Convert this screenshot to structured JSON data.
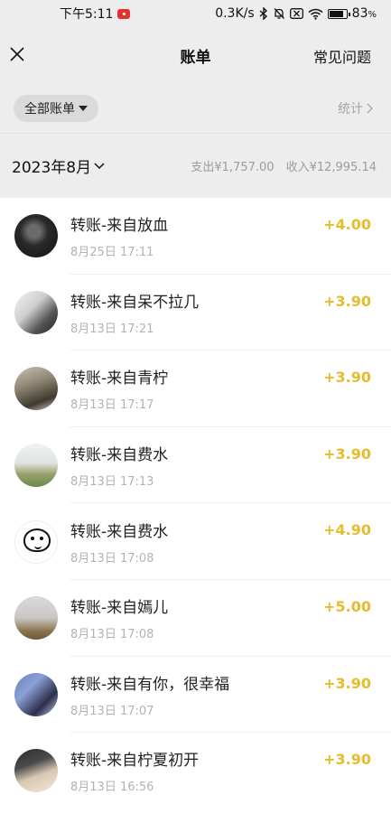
{
  "status_bar": {
    "time": "下午5:11",
    "network_speed": "0.3K/s",
    "battery": "83",
    "battery_unit": "%"
  },
  "header": {
    "title": "账单",
    "faq": "常见问题"
  },
  "filter": {
    "label": "全部账单",
    "stats": "统计"
  },
  "month": {
    "label": "2023年8月",
    "expense": "支出¥1,757.00",
    "income": "收入¥12,995.14"
  },
  "transactions": [
    {
      "title": "转账-来自放血",
      "time": "8月25日 17:11",
      "amount": "+4.00"
    },
    {
      "title": "转账-来自呆不拉几",
      "time": "8月13日 17:21",
      "amount": "+3.90"
    },
    {
      "title": "转账-来自青柠",
      "time": "8月13日 17:17",
      "amount": "+3.90"
    },
    {
      "title": "转账-来自费水",
      "time": "8月13日 17:13",
      "amount": "+3.90"
    },
    {
      "title": "转账-来自费水",
      "time": "8月13日 17:08",
      "amount": "+4.90"
    },
    {
      "title": "转账-来自嫣儿",
      "time": "8月13日 17:08",
      "amount": "+5.00"
    },
    {
      "title": "转账-来自有你，很幸福",
      "time": "8月13日 17:07",
      "amount": "+3.90"
    },
    {
      "title": "转账-来自柠夏初开",
      "time": "8月13日 16:56",
      "amount": "+3.90"
    }
  ],
  "colors": {
    "amount": "#e5bc2c",
    "background": "#ededed"
  }
}
